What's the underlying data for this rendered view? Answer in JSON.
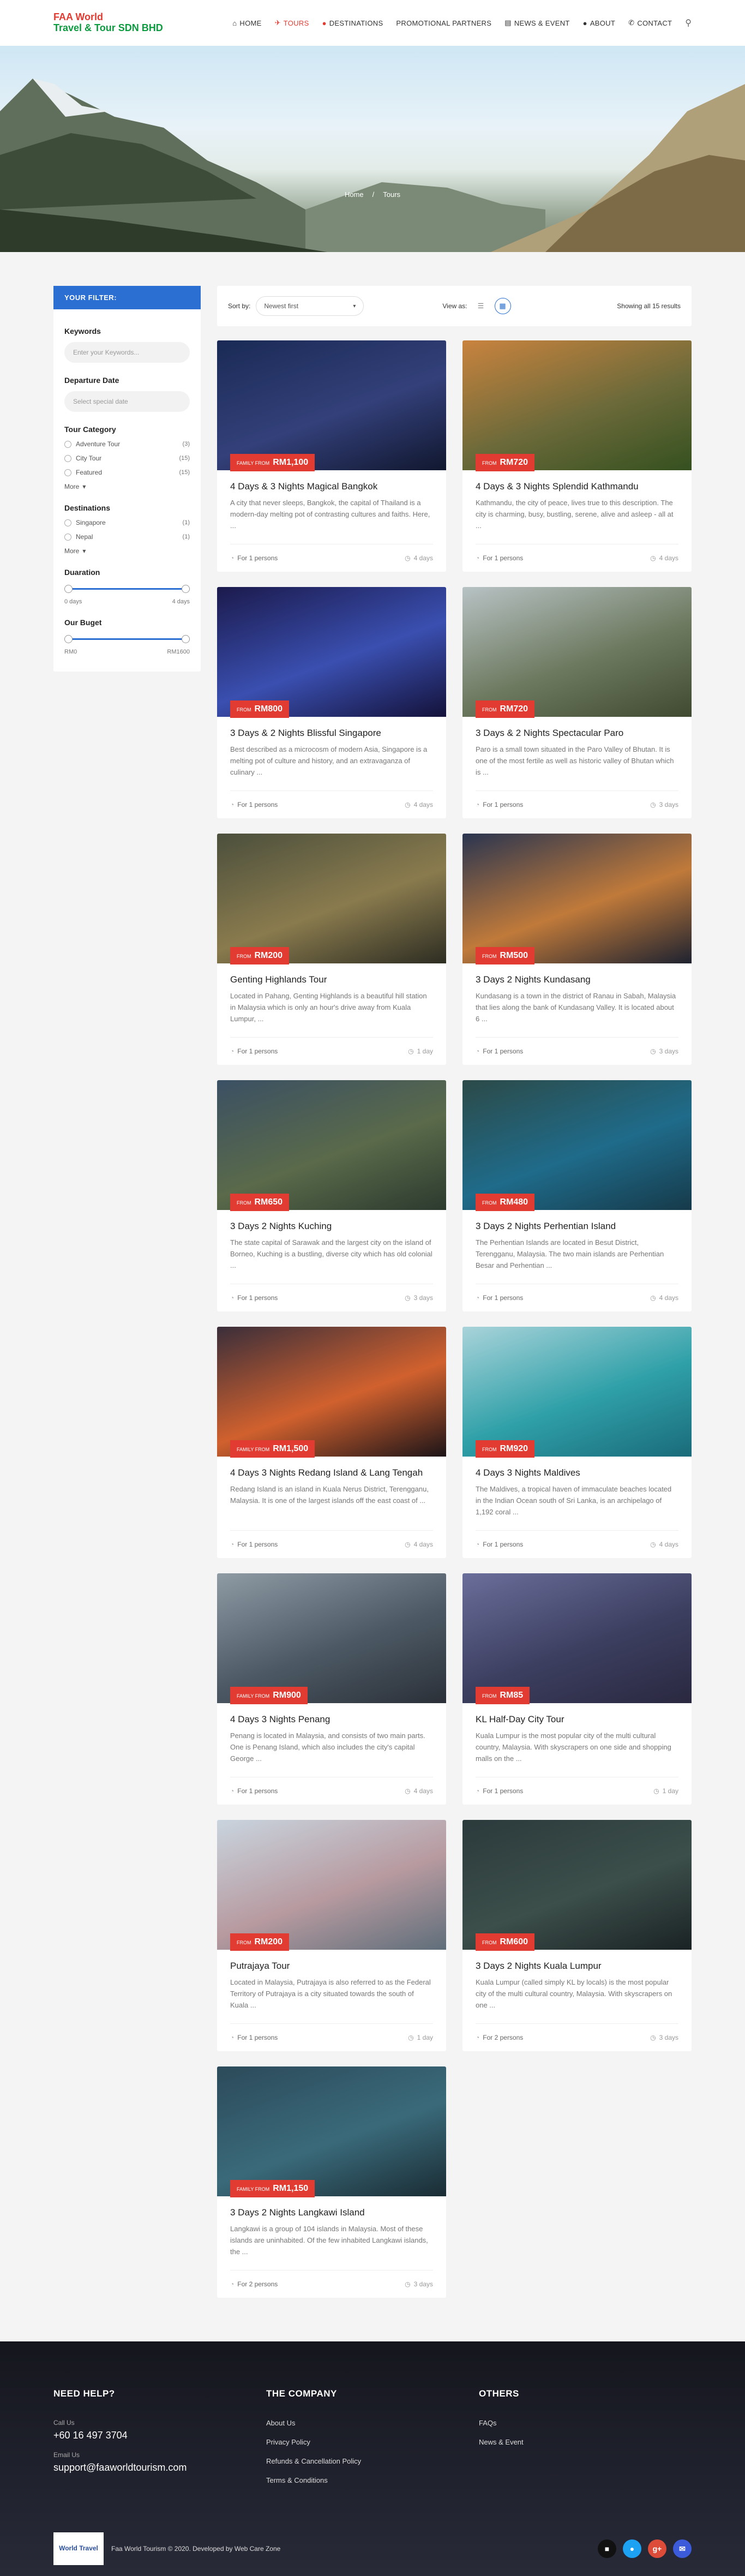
{
  "header": {
    "logo_line1": "FAA World",
    "logo_line2": "Travel & Tour SDN BHD",
    "nav": [
      "HOME",
      "TOURS",
      "DESTINATIONS",
      "PROMOTIONAL PARTNERS",
      "NEWS & EVENT",
      "ABOUT",
      "CONTACT"
    ],
    "active_nav": "TOURS"
  },
  "breadcrumb": {
    "home": "Home",
    "sep": "/",
    "current": "Tours"
  },
  "sidebar": {
    "title": "YOUR FILTER:",
    "keywords_label": "Keywords",
    "keywords_placeholder": "Enter your Keywords...",
    "departure_label": "Departure Date",
    "departure_placeholder": "Select special date",
    "category_label": "Tour Category",
    "categories": [
      {
        "name": "Adventure Tour",
        "count": "(3)"
      },
      {
        "name": "City Tour",
        "count": "(15)"
      },
      {
        "name": "Featured",
        "count": "(15)"
      }
    ],
    "more_label": "More",
    "destinations_label": "Destinations",
    "destinations": [
      {
        "name": "Singapore",
        "count": "(1)"
      },
      {
        "name": "Nepal",
        "count": "(1)"
      }
    ],
    "duration_label": "Duaration",
    "duration_min": "0 days",
    "duration_max": "4 days",
    "budget_label": "Our Buget",
    "budget_min": "RM0",
    "budget_max": "RM1600"
  },
  "toolbar": {
    "sort_label": "Sort by:",
    "sort_value": "Newest first",
    "view_label": "View as:",
    "showing": "Showing all 15 results"
  },
  "tours": [
    {
      "title": "4 Days & 3 Nights Magical Bangkok",
      "from": "FAMILY FROM",
      "price": "RM1,100",
      "desc": "A city that never sleeps, Bangkok, the capital of Thailand is a modern-day melting pot of contrasting cultures and faiths. Here, ...",
      "persons": "For 1 persons",
      "days": "4 days",
      "colors": [
        "#1a2a55",
        "#33407a",
        "#11172f"
      ]
    },
    {
      "title": "4 Days & 3 Nights Splendid Kathmandu",
      "from": "FROM",
      "price": "RM720",
      "desc": "Kathmandu, the city of peace, lives true to this description. The city is charming, busy, bustling, serene, alive and asleep - all at ...",
      "persons": "For 1 persons",
      "days": "4 days",
      "colors": [
        "#c9833e",
        "#6c6a3a",
        "#35501f"
      ]
    },
    {
      "title": "3 Days & 2 Nights Blissful Singapore",
      "from": "FROM",
      "price": "RM800",
      "desc": "Best described as a microcosm of modern Asia, Singapore is a melting pot of culture and history, and an extravaganza of culinary ...",
      "persons": "For 1 persons",
      "days": "4 days",
      "colors": [
        "#1b1a4c",
        "#3a4fb0",
        "#14123a"
      ]
    },
    {
      "title": "3 Days & 2 Nights Spectacular Paro",
      "from": "FROM",
      "price": "RM720",
      "desc": "Paro is a small town situated in the Paro Valley of Bhutan. It is one of the most fertile as well as historic valley of Bhutan which is ...",
      "persons": "For 1 persons",
      "days": "3 days",
      "colors": [
        "#b7c2c4",
        "#6e7a60",
        "#3f4a31"
      ]
    },
    {
      "title": "Genting Highlands Tour",
      "from": "FROM",
      "price": "RM200",
      "desc": "Located in Pahang, Genting Highlands is a beautiful hill station in Malaysia which is only an hour's drive away from Kuala Lumpur, ...",
      "persons": "For 1 persons",
      "days": "1 day",
      "colors": [
        "#4b4f3c",
        "#8a7b4e",
        "#2d2d22"
      ]
    },
    {
      "title": "3 Days 2 Nights Kundasang",
      "from": "FROM",
      "price": "RM500",
      "desc": "Kundasang is a town in the district of Ranau in Sabah, Malaysia that lies along the bank of Kundasang Valley. It is located about 6 ...",
      "persons": "For 1 persons",
      "days": "3 days",
      "colors": [
        "#2a3550",
        "#c07a3a",
        "#1e2230"
      ]
    },
    {
      "title": "3 Days 2 Nights Kuching",
      "from": "FROM",
      "price": "RM650",
      "desc": "The state capital of Sarawak and the largest city on the island of Borneo, Kuching is a bustling, diverse city which has old colonial ...",
      "persons": "For 1 persons",
      "days": "3 days",
      "colors": [
        "#3b5064",
        "#5a6a4a",
        "#2b3a2e"
      ]
    },
    {
      "title": "3 Days 2 Nights Perhentian Island",
      "from": "FROM",
      "price": "RM480",
      "desc": "The Perhentian Islands are located in Besut District, Terengganu, Malaysia. The two main islands are Perhentian Besar and Perhentian ...",
      "persons": "For 1 persons",
      "days": "4 days",
      "colors": [
        "#2c4a48",
        "#1f6b8a",
        "#163a4a"
      ]
    },
    {
      "title": "4 Days 3 Nights Redang Island & Lang Tengah",
      "from": "FAMILY FROM",
      "price": "RM1,500",
      "desc": "Redang Island is an island in Kuala Nerus District, Terengganu, Malaysia. It is one of the largest islands off the east coast of ...",
      "persons": "For 1 persons",
      "days": "4 days",
      "colors": [
        "#3a2e3a",
        "#d1612e",
        "#1c1418"
      ]
    },
    {
      "title": "4 Days 3 Nights Maldives",
      "from": "FROM",
      "price": "RM920",
      "desc": "The Maldives, a tropical haven of immaculate beaches located in the Indian Ocean south of Sri Lanka, is an archipelago of 1,192 coral ...",
      "persons": "For 1 persons",
      "days": "4 days",
      "colors": [
        "#a9d3da",
        "#2fa0a8",
        "#1a6b7a"
      ]
    },
    {
      "title": "4 Days 3 Nights Penang",
      "from": "FAMILY FROM",
      "price": "RM900",
      "desc": "Penang is located in Malaysia, and consists of two main parts. One is Penang Island, which also includes the city's capital George ...",
      "persons": "For 1 persons",
      "days": "4 days",
      "colors": [
        "#8e9aa4",
        "#4c5964",
        "#2b3038"
      ]
    },
    {
      "title": "KL Half-Day City Tour",
      "from": "FROM",
      "price": "RM85",
      "desc": "Kuala Lumpur is the most popular city of the multi cultural country, Malaysia. With skyscrapers on one side and shopping malls on the ...",
      "persons": "For 1 persons",
      "days": "1 day",
      "colors": [
        "#6a6e9a",
        "#3c3f60",
        "#2a2840"
      ]
    },
    {
      "title": "Putrajaya Tour",
      "from": "FROM",
      "price": "RM200",
      "desc": "Located in Malaysia, Putrajaya is also referred to as the Federal Territory of Putrajaya is a city situated towards the south of Kuala ...",
      "persons": "For 1 persons",
      "days": "1 day",
      "colors": [
        "#c9d4de",
        "#b79aa0",
        "#5f6e7a"
      ]
    },
    {
      "title": "3 Days 2 Nights Kuala Lumpur",
      "from": "FROM",
      "price": "RM600",
      "desc": "Kuala Lumpur (called simply KL by locals) is the most popular city of the multi cultural country, Malaysia. With skyscrapers on one ...",
      "persons": "For 2 persons",
      "days": "3 days",
      "colors": [
        "#2b3a3c",
        "#3c4f4a",
        "#1a2224"
      ]
    },
    {
      "title": "3 Days 2 Nights Langkawi Island",
      "from": "FAMILY FROM",
      "price": "RM1,150",
      "desc": "Langkawi is a group of 104 islands in Malaysia. Most of these islands are uninhabited. Of the few inhabited Langkawi islands, the ...",
      "persons": "For 2 persons",
      "days": "3 days",
      "colors": [
        "#2c4a5a",
        "#3a6a7a",
        "#1a2c34"
      ]
    }
  ],
  "footer": {
    "help_title": "NEED HELP?",
    "call_label": "Call Us",
    "phone": "+60 16 497 3704",
    "email_label": "Email Us",
    "email": "support@faaworldtourism.com",
    "company_title": "THE COMPANY",
    "company_links": [
      "About Us",
      "Privacy Policy",
      "Refunds & Cancellation Policy",
      "Terms & Conditions"
    ],
    "others_title": "OTHERS",
    "others_links": [
      "FAQs",
      "News & Event"
    ],
    "copyright": "Faa World Tourism © 2020. Developed by Web Care Zone",
    "logo_text": "World Travel",
    "social": [
      {
        "name": "Facebook",
        "color": "#111111"
      },
      {
        "name": "Twitter",
        "color": "#1da1f2"
      },
      {
        "name": "Google Plus",
        "color": "#dd4b39"
      },
      {
        "name": "Email",
        "color": "#3b5bdb"
      }
    ]
  }
}
